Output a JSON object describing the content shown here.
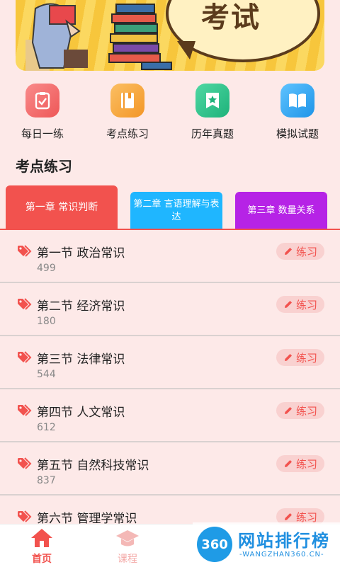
{
  "banner": {
    "bubble_text": "考试"
  },
  "quick_entries": [
    {
      "label": "每日一练",
      "icon": "checklist-icon",
      "color": "#f56b6b"
    },
    {
      "label": "考点练习",
      "icon": "book-icon",
      "color": "#f7a53b"
    },
    {
      "label": "历年真题",
      "icon": "star-badge-icon",
      "color": "#2bc48a"
    },
    {
      "label": "模拟试题",
      "icon": "open-book-icon",
      "color": "#2aa6f2"
    }
  ],
  "section_title": "考点练习",
  "tabs": [
    {
      "label": "第一章 常识判断",
      "color": "#f2524e"
    },
    {
      "label": "第二章 言语理解与表达",
      "color": "#1fb6ff"
    },
    {
      "label": "第三章 数量关系",
      "color": "#b623e6"
    }
  ],
  "items": [
    {
      "name": "第一节 政治常识",
      "count": "499",
      "action": "练习"
    },
    {
      "name": "第二节 经济常识",
      "count": "180",
      "action": "练习"
    },
    {
      "name": "第三节 法律常识",
      "count": "544",
      "action": "练习"
    },
    {
      "name": "第四节 人文常识",
      "count": "612",
      "action": "练习"
    },
    {
      "name": "第五节 自然科技常识",
      "count": "837",
      "action": "练习"
    },
    {
      "name": "第六节 管理学常识",
      "count": "",
      "action": "练习"
    }
  ],
  "bottom_nav": [
    {
      "label": "首页",
      "icon": "home-icon",
      "active": true
    },
    {
      "label": "课程",
      "icon": "graduation-cap-icon",
      "active": false
    }
  ],
  "watermark": {
    "badge": "360",
    "title": "网站排行榜",
    "subtitle": "-WANGZHAN360.CN-"
  },
  "colors": {
    "accent": "#f2524e",
    "background": "#fde9e8"
  }
}
